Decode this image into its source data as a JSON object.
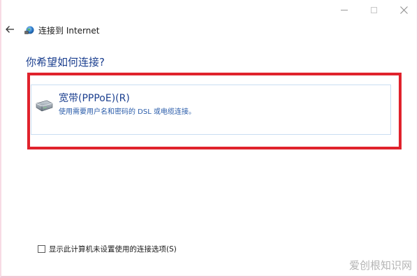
{
  "window": {
    "title": "连接到 Internet",
    "controls": [
      "minimize-icon",
      "maximize-icon",
      "close-icon"
    ]
  },
  "main": {
    "question": "你希望如何连接?",
    "options": [
      {
        "icon": "modem-icon",
        "title": "宽带(PPPoE)(R)",
        "description": "使用需要用户名和密码的 DSL 或电缆连接。"
      }
    ]
  },
  "footer": {
    "checkbox_checked": false,
    "checkbox_label": "显示此计算机未设置使用的连接选项(S)"
  },
  "watermark": "爱创根知识网",
  "colors": {
    "accent_text": "#1b3f8f",
    "highlight_box": "#e0222c",
    "option_border": "#c9def2"
  }
}
